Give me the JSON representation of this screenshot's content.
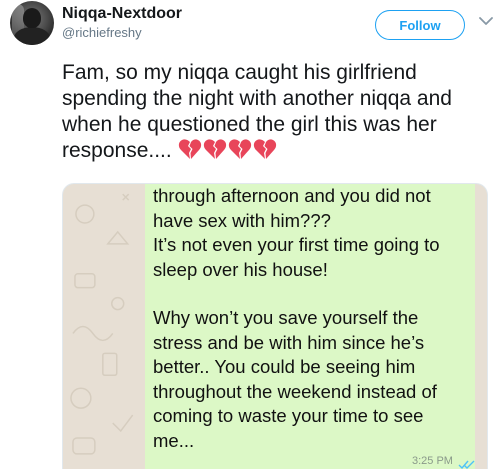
{
  "tweet": {
    "display_name": "Niqqa-Nextdoor",
    "handle": "@richiefreshy",
    "follow_label": "Follow",
    "text": "Fam, so my niqqa caught his girlfriend spending the night with another niqqa and when he questioned the girl this was her response....",
    "emoji_name": "broken-heart",
    "emoji_count": 4,
    "colors": {
      "accent": "#1da1f2",
      "heart": "#e8455a",
      "chat_bubble": "#dcf8c6",
      "chat_wallpaper": "#e7dfd4"
    }
  },
  "chat": {
    "lines_part1": [
      "through afternoon and you did not",
      "have sex with him???",
      "It’s not even your first time going to",
      "sleep over his house!"
    ],
    "lines_part2": [
      "Why won’t you save yourself the",
      "stress and be with him since he’s",
      "better.. You could be seeing him",
      "throughout the weekend instead of",
      "coming to waste your time to see",
      "me..."
    ],
    "time": "3:25 PM",
    "status_icon": "double-check-icon"
  }
}
